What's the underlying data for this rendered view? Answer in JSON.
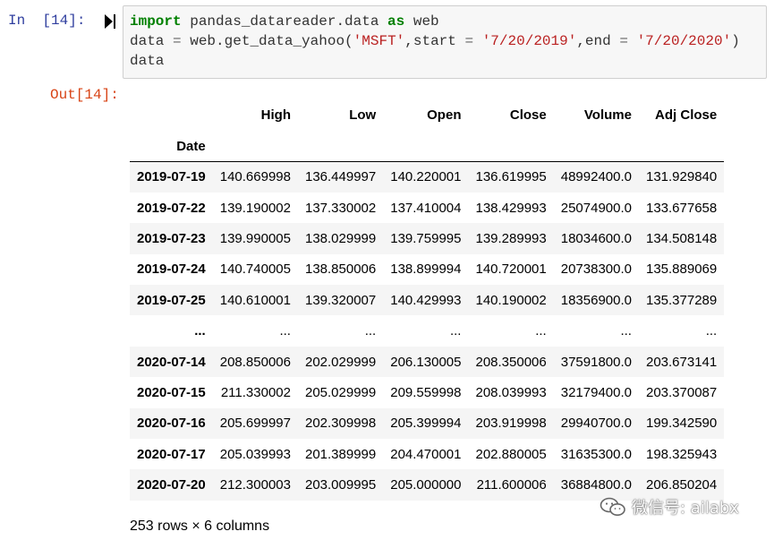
{
  "notebook": {
    "input_prompt": "In  [14]:",
    "output_prompt": "Out[14]:",
    "code": {
      "line1": {
        "kw1": "import",
        "mod": " pandas_datareader.data ",
        "kw2": "as",
        "alias": " web"
      },
      "line2": {
        "lhs": "data ",
        "eq": "=",
        "call": " web.get_data_yahoo(",
        "arg1": "'MSFT'",
        "sep1": ",start ",
        "eq2": "=",
        "sp": " ",
        "arg2": "'7/20/2019'",
        "sep2": ",end ",
        "eq3": "=",
        "sp2": " ",
        "arg3": "'7/20/2020'",
        "close": ")"
      },
      "line3": "data"
    },
    "run_icon": "run-cursor-icon"
  },
  "dataframe": {
    "columns": [
      "High",
      "Low",
      "Open",
      "Close",
      "Volume",
      "Adj Close"
    ],
    "index_name": "Date",
    "rows": [
      {
        "date": "2019-07-19",
        "values": [
          "140.669998",
          "136.449997",
          "140.220001",
          "136.619995",
          "48992400.0",
          "131.929840"
        ]
      },
      {
        "date": "2019-07-22",
        "values": [
          "139.190002",
          "137.330002",
          "137.410004",
          "138.429993",
          "25074900.0",
          "133.677658"
        ]
      },
      {
        "date": "2019-07-23",
        "values": [
          "139.990005",
          "138.029999",
          "139.759995",
          "139.289993",
          "18034600.0",
          "134.508148"
        ]
      },
      {
        "date": "2019-07-24",
        "values": [
          "140.740005",
          "138.850006",
          "138.899994",
          "140.720001",
          "20738300.0",
          "135.889069"
        ]
      },
      {
        "date": "2019-07-25",
        "values": [
          "140.610001",
          "139.320007",
          "140.429993",
          "140.190002",
          "18356900.0",
          "135.377289"
        ]
      },
      {
        "date": "...",
        "values": [
          "...",
          "...",
          "...",
          "...",
          "...",
          "..."
        ]
      },
      {
        "date": "2020-07-14",
        "values": [
          "208.850006",
          "202.029999",
          "206.130005",
          "208.350006",
          "37591800.0",
          "203.673141"
        ]
      },
      {
        "date": "2020-07-15",
        "values": [
          "211.330002",
          "205.029999",
          "209.559998",
          "208.039993",
          "32179400.0",
          "203.370087"
        ]
      },
      {
        "date": "2020-07-16",
        "values": [
          "205.699997",
          "202.309998",
          "205.399994",
          "203.919998",
          "29940700.0",
          "199.342590"
        ]
      },
      {
        "date": "2020-07-17",
        "values": [
          "205.039993",
          "201.389999",
          "204.470001",
          "202.880005",
          "31635300.0",
          "198.325943"
        ]
      },
      {
        "date": "2020-07-20",
        "values": [
          "212.300003",
          "203.009995",
          "205.000000",
          "211.600006",
          "36884800.0",
          "206.850204"
        ]
      }
    ],
    "summary": "253 rows × 6 columns"
  },
  "watermark": {
    "text": "微信号: ailabx",
    "icon": "wechat-icon"
  },
  "colors": {
    "input_prompt": "#303f9f",
    "output_prompt": "#d84315",
    "keyword": "#008000",
    "string": "#ba2121",
    "code_bg": "#f7f7f7",
    "row_stripe": "#f5f5f5"
  }
}
